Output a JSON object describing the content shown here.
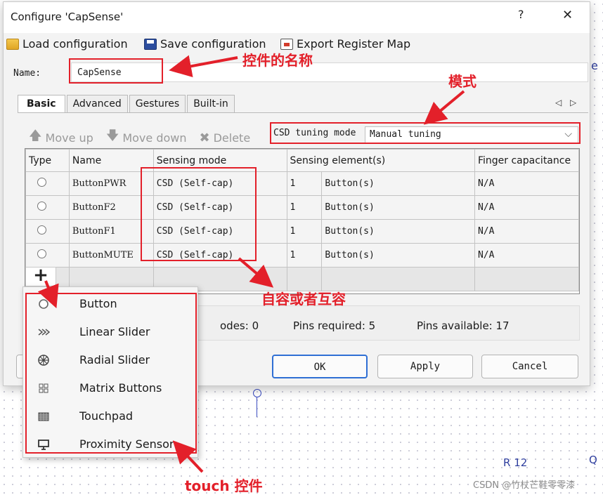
{
  "dialog": {
    "title": "Configure 'CapSense'",
    "help_glyph": "?",
    "close_glyph": "✕"
  },
  "toolbar": {
    "load": "Load configuration",
    "save": "Save configuration",
    "export": "Export Register Map"
  },
  "name_field": {
    "label": "Name:",
    "value": "CapSense"
  },
  "tabs": [
    {
      "label": "Basic",
      "active": true
    },
    {
      "label": "Advanced",
      "active": false
    },
    {
      "label": "Gestures",
      "active": false
    },
    {
      "label": "Built-in",
      "active": false
    }
  ],
  "tab_nav": "◁ ▷",
  "actions": {
    "move_up": "Move up",
    "move_down": "Move down",
    "delete": "Delete"
  },
  "tuning": {
    "label": "CSD tuning mode",
    "value": "Manual tuning"
  },
  "table": {
    "headers": [
      "Type",
      "Name",
      "Sensing mode",
      "Sensing element(s)",
      "Finger capacitance"
    ],
    "rows": [
      {
        "name": "ButtonPWR",
        "mode": "CSD (Self-cap)",
        "count": "1",
        "element": "Button(s)",
        "finger": "N/A"
      },
      {
        "name": "ButtonF2",
        "mode": "CSD (Self-cap)",
        "count": "1",
        "element": "Button(s)",
        "finger": "N/A"
      },
      {
        "name": "ButtonF1",
        "mode": "CSD (Self-cap)",
        "count": "1",
        "element": "Button(s)",
        "finger": "N/A"
      },
      {
        "name": "ButtonMUTE",
        "mode": "CSD (Self-cap)",
        "count": "1",
        "element": "Button(s)",
        "finger": "N/A"
      }
    ]
  },
  "status": {
    "electrodes": "odes: 0",
    "pins_required": "Pins required: 5",
    "pins_available": "Pins available: 17"
  },
  "buttons": {
    "ok": "OK",
    "apply": "Apply",
    "cancel": "Cancel"
  },
  "add_menu": {
    "items": [
      {
        "label": "Button",
        "icon": "button-icon"
      },
      {
        "label": "Linear Slider",
        "icon": "linear-slider-icon"
      },
      {
        "label": "Radial Slider",
        "icon": "radial-slider-icon"
      },
      {
        "label": "Matrix Buttons",
        "icon": "matrix-buttons-icon"
      },
      {
        "label": "Touchpad",
        "icon": "touchpad-icon"
      },
      {
        "label": "Proximity Sensor",
        "icon": "proximity-sensor-icon"
      }
    ]
  },
  "annotations": {
    "name_note": "控件的名称",
    "mode_note": "模式",
    "sensing_note": "自容或者互容",
    "touch_note": "touch 控件"
  },
  "schematic": {
    "label_r": "R 12",
    "label_q": "Q",
    "label_e": "e"
  },
  "watermark": "CSDN @竹杖芒鞋零零漆",
  "colors": {
    "annotation": "#e3202a",
    "accent": "#2f6fd4",
    "schematic": "#2e3e9e"
  }
}
